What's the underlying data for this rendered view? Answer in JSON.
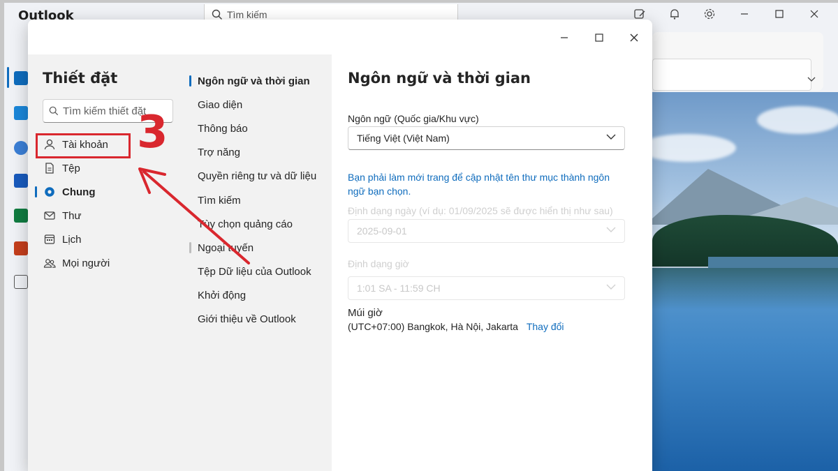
{
  "app": {
    "title": "Outlook",
    "search_placeholder": "Tìm kiếm"
  },
  "settings": {
    "title": "Thiết đặt",
    "search_placeholder": "Tìm kiếm thiết đặt",
    "nav": [
      {
        "label": "Tài khoản",
        "icon": "person-icon"
      },
      {
        "label": "Tệp",
        "icon": "file-icon"
      },
      {
        "label": "Chung",
        "icon": "gear-icon",
        "active": true
      },
      {
        "label": "Thư",
        "icon": "mail-icon"
      },
      {
        "label": "Lịch",
        "icon": "calendar-icon"
      },
      {
        "label": "Mọi người",
        "icon": "people-icon"
      }
    ],
    "subnav": [
      {
        "label": "Ngôn ngữ và thời gian",
        "active": true
      },
      {
        "label": "Giao diện"
      },
      {
        "label": "Thông báo"
      },
      {
        "label": "Trợ năng"
      },
      {
        "label": "Quyền riêng tư và dữ liệu"
      },
      {
        "label": "Tìm kiếm"
      },
      {
        "label": "Tùy chọn quảng cáo"
      },
      {
        "label": "Ngoại tuyến"
      },
      {
        "label": "Tệp Dữ liệu của Outlook"
      },
      {
        "label": "Khởi động"
      },
      {
        "label": "Giới thiệu về Outlook"
      }
    ]
  },
  "page": {
    "title": "Ngôn ngữ và thời gian",
    "language_label": "Ngôn ngữ (Quốc gia/Khu vực)",
    "language_value": "Tiếng Việt (Việt Nam)",
    "language_note": "Bạn phải làm mới trang để cập nhật tên thư mục thành ngôn ngữ bạn chọn.",
    "date_format_label": "Định dạng ngày (ví dụ: 01/09/2025 sẽ được hiển thị như sau)",
    "date_format_value": "2025-09-01",
    "time_format_label": "Định dạng giờ",
    "time_format_value": "1:01 SA - 11:59 CH",
    "timezone_label": "Múi giờ",
    "timezone_value": "(UTC+07:00) Bangkok, Hà Nội, Jakarta",
    "timezone_change": "Thay đổi"
  },
  "annotation": {
    "step": "3",
    "color": "#d9272e"
  },
  "colors": {
    "accent": "#0f6cbd"
  }
}
